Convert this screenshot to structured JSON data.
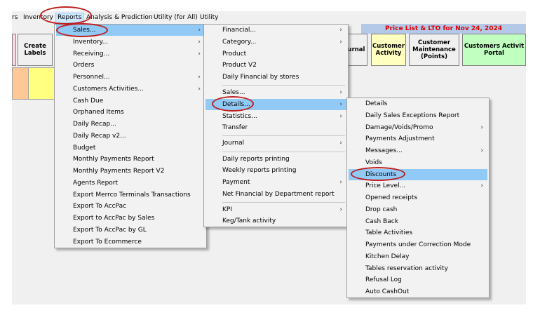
{
  "menubar": {
    "items": [
      "rs",
      "Inventory",
      "Reports",
      "Analysis & Prediction",
      "Utility (for All)",
      "Utility"
    ]
  },
  "header": {
    "price_list_title": "Price List & LTO for  Nov 24, 2024"
  },
  "toolbar": {
    "create_labels": "Create Labels",
    "journal": "urnal",
    "customer_activity": "Customer Activity",
    "customer_maintenance": "Customer Maintenance (Points)",
    "customer_maintenance_underline": "C",
    "customers_activity_portal": "Customers Activit Portal"
  },
  "menu_reports": {
    "items": [
      "Sales...",
      "Inventory...",
      "Receiving...",
      "Orders",
      "Personnel...",
      "Customers Activities...",
      "Cash Due",
      "Orphaned Items",
      "Daily Recap...",
      "Daily Recap v2...",
      "Budget",
      "Monthly Payments Report",
      "Monthly Payments Report V2",
      "Agents Report",
      "Export Merrco Terminals Transactions",
      "Export To AccPac",
      "Export to AccPac by Sales",
      "Export To AccPac by GL",
      "Export To Ecommerce"
    ]
  },
  "menu_sales": {
    "items": [
      "Financial...",
      "Category...",
      "Product",
      "Product V2",
      "Daily Financial by stores",
      "Sales...",
      "Details...",
      "Statistics...",
      "Transfer",
      "Journal",
      "Daily reports printing",
      "Weekly reports printing",
      "Payment",
      "Net Financial by Department report",
      "KPI",
      "Keg/Tank activity"
    ]
  },
  "menu_details": {
    "items": [
      "Details",
      "Daily Sales Exceptions Report",
      "Damage/Voids/Promo",
      "Payments Adjustment",
      "Messages...",
      "Voids",
      "Discounts",
      "Price Level...",
      "Opened receipts",
      "Drop cash",
      "Cash Back",
      "Table Activities",
      "Payments under Correction Mode",
      "Kitchen Delay",
      "Tables reservation activity",
      "Refusal Log",
      "Auto CashOut"
    ]
  },
  "submenu_arrow": "›",
  "colors": {
    "highlight": "#91c9f7",
    "annotation_oval": "#c0201f",
    "title_text": "#e00000",
    "customer_activity_bg": "#ffffc0",
    "portal_bg": "#c0ffc0",
    "pink_bg": "#ffd8e8",
    "orange_swatch": "#ffc896",
    "yellow_swatch": "#ffff80"
  }
}
